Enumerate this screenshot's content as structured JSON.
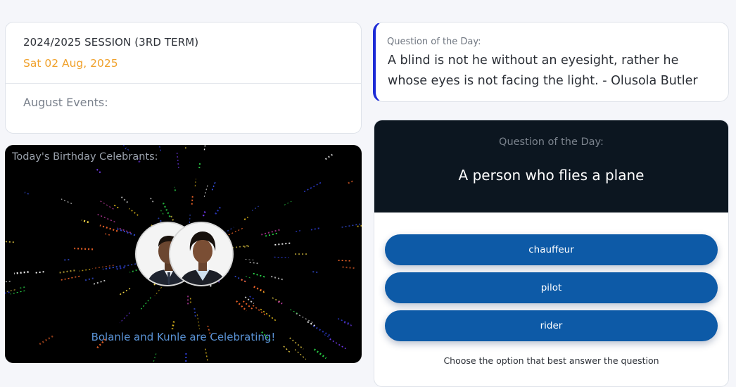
{
  "session": {
    "title": "2024/2025 SESSION (3RD TERM)",
    "date": "Sat 02 Aug, 2025",
    "events_label": "August Events:"
  },
  "birthday": {
    "label": "Today's Birthday Celebrants:",
    "message": "Bolanle and Kunle are Celebrating!"
  },
  "quote": {
    "label": "Question of the Day:",
    "text": "A blind is not he without an eyesight, rather he whose eyes is not facing the light. - Olusola Butler"
  },
  "quiz": {
    "label": "Question of the Day:",
    "question": "A person who flies a plane",
    "options": [
      "chauffeur",
      "pilot",
      "rider"
    ],
    "instruction": "Choose the option that best answer the question"
  },
  "colors": {
    "accent_orange": "#f0a12b",
    "quote_border": "#1c2bd6",
    "option_blue": "#0d5aa7",
    "quiz_header": "#0c1620"
  }
}
